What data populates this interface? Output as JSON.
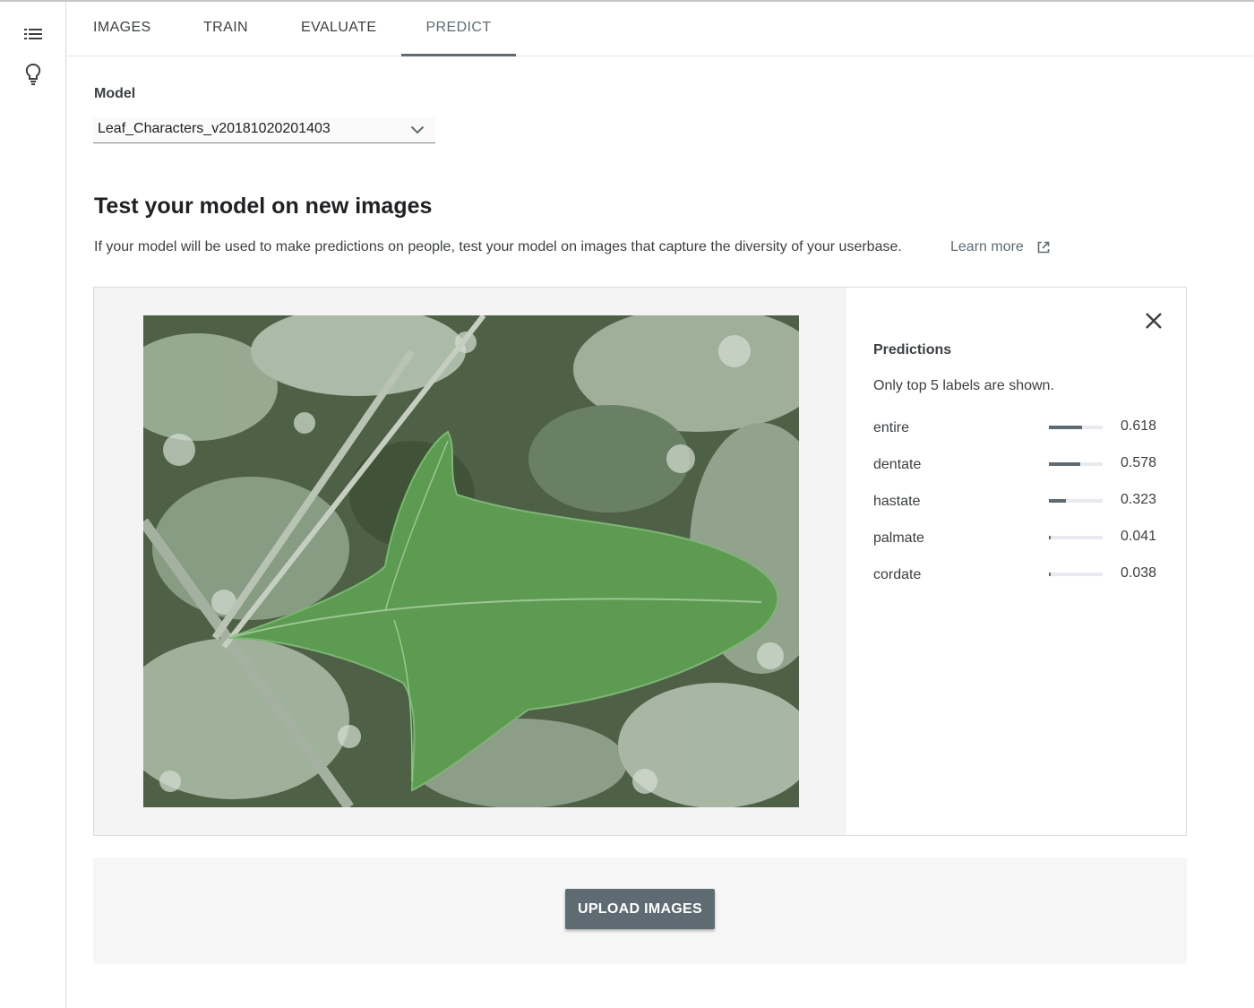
{
  "tabs": [
    {
      "label": "IMAGES"
    },
    {
      "label": "TRAIN"
    },
    {
      "label": "EVALUATE"
    },
    {
      "label": "PREDICT",
      "active": true
    }
  ],
  "model": {
    "label": "Model",
    "selected": "Leaf_Characters_v20181020201403"
  },
  "section": {
    "title": "Test your model on new images",
    "description": "If your model will be used to make predictions on people, test your model on images that capture the diversity of your userbase.",
    "learn_more": "Learn more"
  },
  "predictions": {
    "title": "Predictions",
    "note": "Only top 5 labels are shown.",
    "items": [
      {
        "label": "entire",
        "score": "0.618",
        "value": 0.618
      },
      {
        "label": "dentate",
        "score": "0.578",
        "value": 0.578
      },
      {
        "label": "hastate",
        "score": "0.323",
        "value": 0.323
      },
      {
        "label": "palmate",
        "score": "0.041",
        "value": 0.041
      },
      {
        "label": "cordate",
        "score": "0.038",
        "value": 0.038
      }
    ]
  },
  "upload": {
    "label": "UPLOAD IMAGES"
  },
  "icons": {
    "menu": "list-icon",
    "tips": "lightbulb-icon",
    "dropdown": "chevron-down-icon",
    "external": "open-in-new-icon",
    "close": "close-icon"
  },
  "colors": {
    "accent": "#5f6b73",
    "text": "#3c4043"
  }
}
